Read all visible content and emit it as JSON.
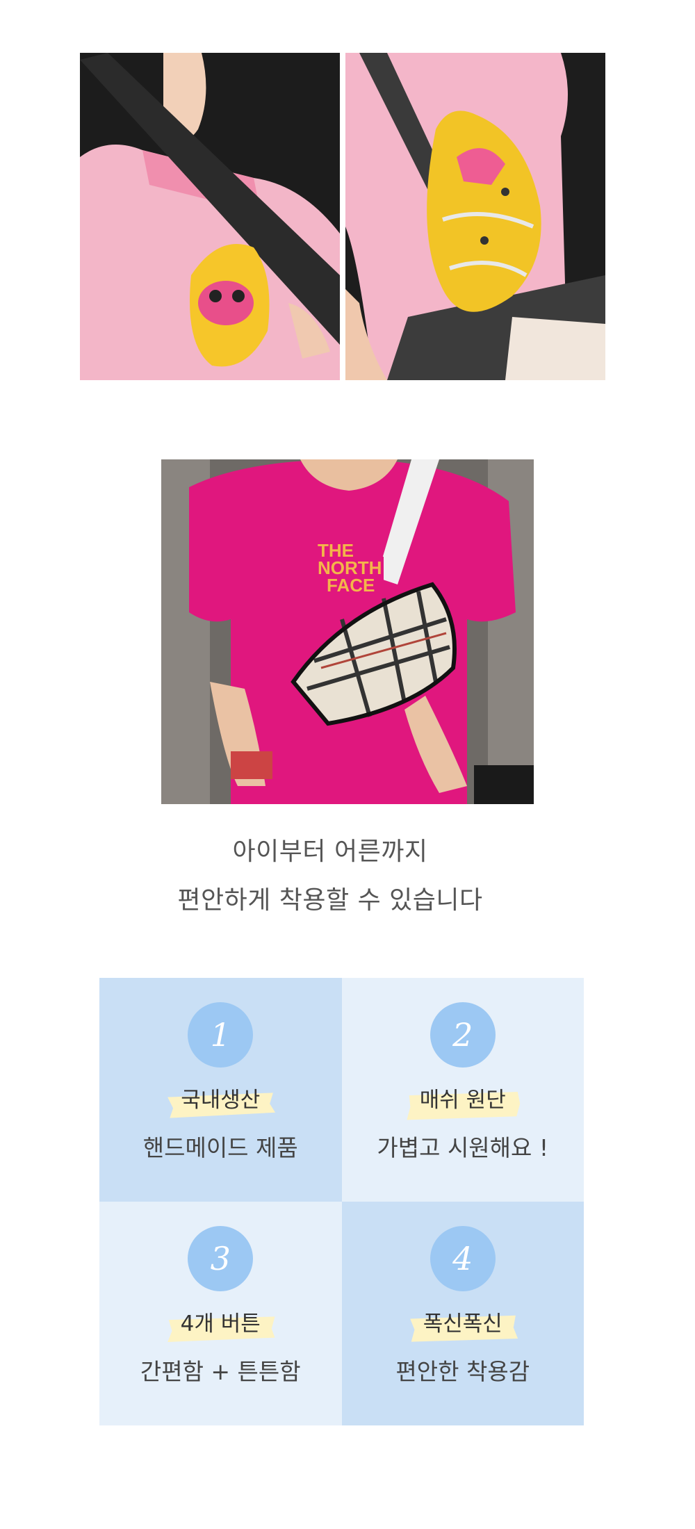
{
  "caption": {
    "line1": "아이부터 어른까지",
    "line2": "편안하게 착용할 수 있습니다"
  },
  "features": [
    {
      "number": "1",
      "title": "국내생산",
      "desc": "핸드메이드 제품"
    },
    {
      "number": "2",
      "title": "매쉬 원단",
      "desc": "가볍고 시원해요 !"
    },
    {
      "number": "3",
      "title": "4개 버튼",
      "desc": "간편함 + 튼튼함"
    },
    {
      "number": "4",
      "title": "폭신폭신",
      "desc": "편안한 착용감"
    }
  ],
  "colors": {
    "cell_dark": "#c9dff5",
    "cell_light": "#e6f0fa",
    "number_circle": "#9cc8f3",
    "highlight_brush": "#fdf3c4",
    "text": "#444444"
  },
  "photos": [
    {
      "name": "child-seatbelt-without-cover"
    },
    {
      "name": "child-seatbelt-with-yellow-cover"
    },
    {
      "name": "adult-seatbelt-with-check-cover"
    }
  ]
}
